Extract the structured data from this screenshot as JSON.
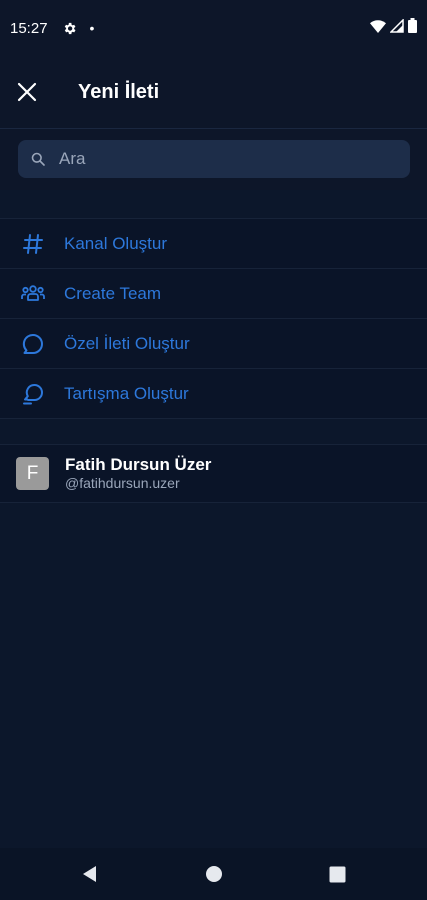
{
  "status_bar": {
    "time": "15:27",
    "icons": [
      "gear-icon",
      "notification-dot-icon",
      "wifi-icon",
      "signal-icon",
      "battery-icon"
    ]
  },
  "app_bar": {
    "close_icon": "close-icon",
    "title": "Yeni İleti"
  },
  "search": {
    "icon": "search-icon",
    "placeholder": "Ara",
    "value": ""
  },
  "actions": [
    {
      "icon": "hashtag-icon",
      "label": "Kanal Oluştur"
    },
    {
      "icon": "team-icon",
      "label": "Create Team"
    },
    {
      "icon": "chat-bubble-icon",
      "label": "Özel İleti Oluştur"
    },
    {
      "icon": "discussion-icon",
      "label": "Tartışma Oluştur"
    }
  ],
  "users": [
    {
      "avatar_letter": "F",
      "name": "Fatih Dursun Üzer",
      "username": "@fatihdursun.uzer"
    }
  ],
  "nav_bar": {
    "icons": [
      "back-icon",
      "home-icon",
      "recents-icon"
    ]
  },
  "colors": {
    "background": "#0c172b",
    "header": "#0d1629",
    "search_box": "#1d2d49",
    "accent": "#2d78db",
    "avatar": "#9a9a9a",
    "muted_text": "#9aa6ba"
  }
}
